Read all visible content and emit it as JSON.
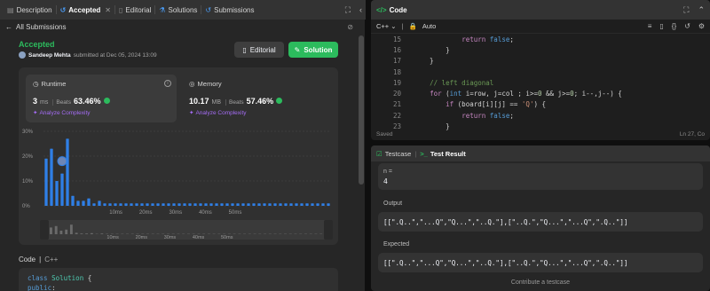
{
  "left_tabs": [
    {
      "label": "Description",
      "icon": "description-icon"
    },
    {
      "label": "Accepted",
      "icon": "history-icon"
    },
    {
      "label": "Editorial",
      "icon": "book-icon"
    },
    {
      "label": "Solutions",
      "icon": "flask-icon"
    },
    {
      "label": "Submissions",
      "icon": "history-icon"
    }
  ],
  "subbar": {
    "back_label": "All Submissions"
  },
  "submission": {
    "status": "Accepted",
    "author": "Sandeep Mehta",
    "submitted_text": "submitted at Dec 05, 2024 13:09",
    "editorial_btn": "Editorial",
    "solution_btn": "Solution"
  },
  "runtime": {
    "title": "Runtime",
    "value": "3",
    "unit": "ms",
    "beats_label": "Beats",
    "beats": "63.46%",
    "analyze": "Analyze Complexity"
  },
  "memory": {
    "title": "Memory",
    "value": "10.17",
    "unit": "MB",
    "beats_label": "Beats",
    "beats": "57.46%",
    "analyze": "Analyze Complexity"
  },
  "chart_data": {
    "type": "bar",
    "y_ticks": [
      "30%",
      "20%",
      "10%",
      "0%"
    ],
    "ylim": [
      0,
      30
    ],
    "x_ticks": [
      "10ms",
      "20ms",
      "30ms",
      "40ms",
      "50ms"
    ],
    "mini_x_ticks": [
      "10ms",
      "20ms",
      "30ms",
      "40ms",
      "50ms"
    ],
    "values": [
      19,
      23,
      10,
      13,
      27,
      4,
      2,
      2,
      3,
      1,
      2,
      1,
      1,
      1,
      1,
      1,
      1,
      1,
      1,
      1,
      1,
      1,
      1,
      1,
      1,
      1,
      1,
      1,
      1,
      1,
      1,
      1,
      1,
      1,
      1,
      1,
      1,
      1,
      1,
      1,
      1,
      1,
      1,
      1,
      1,
      1,
      1,
      1,
      1,
      1,
      1,
      1,
      1,
      1
    ],
    "highlight_index": 3,
    "bar_color": "#2f7fe6",
    "highlight_color": "#2f7fe6"
  },
  "code_section": {
    "title": "Code",
    "lang": "C++",
    "lines": [
      "class Solution {",
      "public:"
    ]
  },
  "editor": {
    "title": "Code",
    "lang": "C++",
    "mode": "Auto",
    "status_left": "Saved",
    "status_right": "Ln 27, Co",
    "lines": [
      {
        "n": "15",
        "indent": "            ",
        "code": "return false;"
      },
      {
        "n": "16",
        "indent": "        ",
        "code": "}"
      },
      {
        "n": "17",
        "indent": "    ",
        "code": "}"
      },
      {
        "n": "18",
        "indent": "",
        "code": ""
      },
      {
        "n": "19",
        "indent": "    ",
        "code": "// left diagonal"
      },
      {
        "n": "20",
        "indent": "    ",
        "code": "for (int i=row, j=col ; i>=0 && j>=0; i--,j--) {"
      },
      {
        "n": "21",
        "indent": "        ",
        "code": "if (board[i][j] == 'Q') {"
      },
      {
        "n": "22",
        "indent": "            ",
        "code": "return false;"
      },
      {
        "n": "23",
        "indent": "        ",
        "code": "}"
      }
    ]
  },
  "test": {
    "tab_testcase": "Testcase",
    "tab_result": "Test Result",
    "n_label": "n =",
    "n_value": "4",
    "output_label": "Output",
    "output_value": "[[\".Q..\",\"...Q\",\"Q...\",\"..Q.\"],[\"..Q.\",\"Q...\",\"...Q\",\".Q..\"]]",
    "expected_label": "Expected",
    "expected_value": "[[\".Q..\",\"...Q\",\"Q...\",\"..Q.\"],[\"..Q.\",\"Q...\",\"...Q\",\".Q..\"]]",
    "footer": "Contribute a testcase"
  }
}
